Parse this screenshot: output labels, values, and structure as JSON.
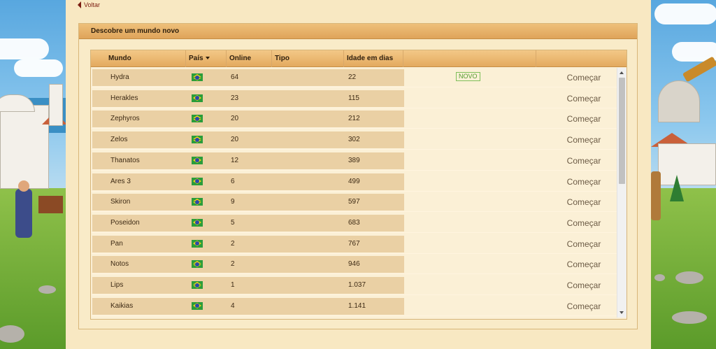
{
  "nav": {
    "back_label": "Voltar"
  },
  "panel": {
    "title": "Descobre um mundo novo"
  },
  "table": {
    "columns": {
      "world": "Mundo",
      "country": "País",
      "online": "Online",
      "type": "Tipo",
      "age": "Idade em dias"
    },
    "start_label": "Começar",
    "new_badge": "NOVO",
    "rows": [
      {
        "name": "Hydra",
        "online": "64",
        "age": "22",
        "is_new": true
      },
      {
        "name": "Herakles",
        "online": "23",
        "age": "115",
        "is_new": false
      },
      {
        "name": "Zephyros",
        "online": "20",
        "age": "212",
        "is_new": false
      },
      {
        "name": "Zelos",
        "online": "20",
        "age": "302",
        "is_new": false
      },
      {
        "name": "Thanatos",
        "online": "12",
        "age": "389",
        "is_new": false
      },
      {
        "name": "Ares 3",
        "online": "6",
        "age": "499",
        "is_new": false
      },
      {
        "name": "Skiron",
        "online": "9",
        "age": "597",
        "is_new": false
      },
      {
        "name": "Poseidon",
        "online": "5",
        "age": "683",
        "is_new": false
      },
      {
        "name": "Pan",
        "online": "2",
        "age": "767",
        "is_new": false
      },
      {
        "name": "Notos",
        "online": "2",
        "age": "946",
        "is_new": false
      },
      {
        "name": "Lips",
        "online": "1",
        "age": "1.037",
        "is_new": false
      },
      {
        "name": "Kaikias",
        "online": "4",
        "age": "1.141",
        "is_new": false
      }
    ]
  },
  "icons": {
    "back": "back-arrow-icon",
    "flag": "brazil-flag-icon",
    "sort": "sort-caret-icon"
  },
  "colors": {
    "panel_bg": "#f8e8c2",
    "header_bg": "#e3aa5f",
    "row_bg": "#ead0a4",
    "link": "#7a1c10",
    "new_badge": "#4f9a2e"
  }
}
